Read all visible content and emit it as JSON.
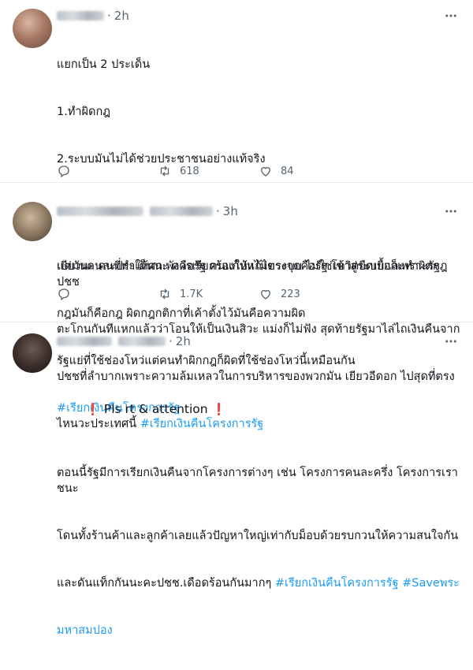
{
  "tweets": [
    {
      "time": "2h",
      "lines": [
        "แยกเป็น 2 ประเด็น",
        "1.ทำผิดกฎ",
        "2.ระบบมันไม่ได้ช่วยประชาชนอย่างแท้จริง",
        "",
        "แต่มันคนละประเด็นนะ ควรเรียกร้องให้แก้ไขระบบ ไม่ใช่เข้าสู่ระบบและทำผิดกฎ",
        "กฎมันก็คือกฎ ผิดกฎกติกาที่เค้าตั้งไว้มันคือความผิด",
        "รัฐแย่ที่ใช้ช่องโหว่แต่คนทำผิกกฎก็ผิดที่ใช้ช่องโหว่นี้เหมือนกัน"
      ],
      "hashtag": "#เรียกเงินคืนโครงการรัฐ",
      "retweets": "618",
      "likes": "84"
    },
    {
      "time": "3h",
      "line1": "เยียวนะ คนที่ทำให้ศก.พังคือรัฐ คนแก้ปหไม่ตรงจุดคือรัฐ โควิดยืดเยื้อก็เพราะรัฐ ปชช",
      "line2": "ตะโกนกันทีแหกแล้วว่าโอนให้เป็นเงินสิวะ แม่งก็ไม่ฟัง สุดท้ายรัฐมาไล่ไถเงินคืนจาก",
      "line3": "ปชชที่ลำบากเพราะความล้มเหลวในการบริหารของพวกมัน เยียวอีดอก ไปสุดที่ตรง",
      "line4": "ไหนวะประเทศนี้",
      "hashtag": "#เรียกเงินคืนโครงการรัฐ",
      "retweets": "1.7K",
      "likes": "223"
    },
    {
      "time": "2h",
      "mark": "❗",
      "title": " Pls rt & attention ",
      "line1": "ตอนนี้รัฐมีการเรียกเงินคืนจากโครงการต่างๆ เช่น โครงการคนละครึ่ง โครงการเราชนะ",
      "line2": "โดนทั้งร้านค้าและลูกค้าเลยแล้วปัญหาใหญ่เท่ากับม็อบด้วยรบกวนให้ความสนใจกัน",
      "line3_prefix": "และดันแท็กกันนะคะปชช.เดือดร้อนกันมากๆ ",
      "hashtag1": "#เรียกเงินคืนโครงการรัฐ",
      "hashtag2": "#Saveพระ",
      "line4": "มหาสมปอง"
    }
  ],
  "icons": {
    "more": "more-dots-icon",
    "reply": "reply-icon",
    "retweet": "retweet-icon",
    "like": "heart-icon"
  },
  "colors": {
    "hashtag": "#1d9bf0",
    "muted": "#536471",
    "alert": "#e0245e"
  }
}
